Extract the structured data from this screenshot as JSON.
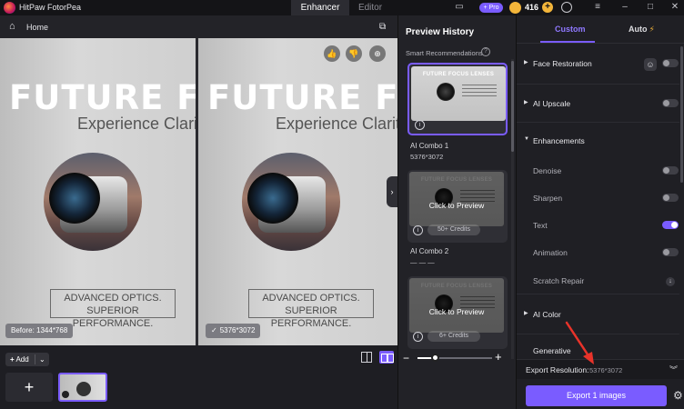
{
  "titlebar": {
    "app_title": "HitPaw FotorPea",
    "tabs": [
      "Enhancer",
      "Editor"
    ],
    "pro_label": "+ Pro",
    "credits": "416"
  },
  "workspace": {
    "home_label": "Home",
    "poster": {
      "title": "FUTURE FOCUS LENSES",
      "subtitle": "Experience Clarity",
      "box_line1": "ADVANCED OPTICS.",
      "box_line2": "SUPERIOR PERFORMANCE."
    },
    "before_badge": "Before: 1344*768",
    "after_badge": "5376*3072"
  },
  "bottom": {
    "add_label": "Add"
  },
  "history": {
    "title": "Preview History",
    "smart_label": "Smart Recommendations",
    "cards": [
      {
        "label": "AI Combo 1",
        "dims": "5376*3072",
        "head": "FUTURE FOCUS LENSES"
      },
      {
        "label": "AI Combo 2",
        "dims": "— — —",
        "head": "FUTURE FOCUS LENSES",
        "overlay": "Click to Preview",
        "credits": "50+ Credits"
      },
      {
        "head": "FUTURE FOCUS LENSES",
        "overlay": "Click to Preview",
        "credits": "6+ Credits"
      }
    ],
    "zoom_percent": 25
  },
  "settings": {
    "tabs": {
      "custom": "Custom",
      "auto": "Auto"
    },
    "face_restoration": "Face Restoration",
    "ai_upscale": "AI Upscale",
    "enhancements": "Enhancements",
    "denoise": "Denoise",
    "sharpen": "Sharpen",
    "text": "Text",
    "animation": "Animation",
    "scratch_repair": "Scratch Repair",
    "ai_color": "AI Color",
    "generative": "Generative",
    "toggles": {
      "face_restoration": false,
      "ai_upscale": false,
      "denoise": false,
      "sharpen": false,
      "text": true,
      "animation": false
    },
    "export_res_label": "Export Resolution:",
    "export_res_value": "5376*3072",
    "export_button": "Export 1 images"
  },
  "colors": {
    "accent": "#7a5cff",
    "coin": "#f3b53a",
    "arrow": "#e8332a"
  }
}
